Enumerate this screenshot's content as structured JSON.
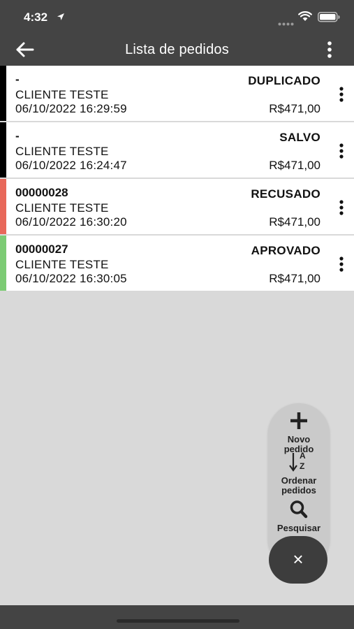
{
  "status_bar": {
    "time": "4:32"
  },
  "app_bar": {
    "title": "Lista de pedidos"
  },
  "orders": [
    {
      "number": "-",
      "status": "DUPLICADO",
      "client": "CLIENTE TESTE",
      "datetime": "06/10/2022 16:29:59",
      "total": "R$471,00",
      "stripe_color": "#000000"
    },
    {
      "number": "-",
      "status": "SALVO",
      "client": "CLIENTE TESTE",
      "datetime": "06/10/2022 16:24:47",
      "total": "R$471,00",
      "stripe_color": "#000000"
    },
    {
      "number": "00000028",
      "status": "RECUSADO",
      "client": "CLIENTE TESTE",
      "datetime": "06/10/2022 16:30:20",
      "total": "R$471,00",
      "stripe_color": "#e8685a"
    },
    {
      "number": "00000027",
      "status": "APROVADO",
      "client": "CLIENTE TESTE",
      "datetime": "06/10/2022 16:30:05",
      "total": "R$471,00",
      "stripe_color": "#7ccb74"
    }
  ],
  "fab_menu": {
    "new_order_line1": "Novo",
    "new_order_line2": "pedido",
    "sort_line1": "Ordenar",
    "sort_line2": "pedidos",
    "search": "Pesquisar",
    "sort_icon_letter_top": "A",
    "sort_icon_letter_bottom": "Z"
  },
  "colors": {
    "bar": "#444444",
    "background": "#d9d9d9",
    "card": "#ffffff",
    "fab_close": "#3d3d3d"
  }
}
